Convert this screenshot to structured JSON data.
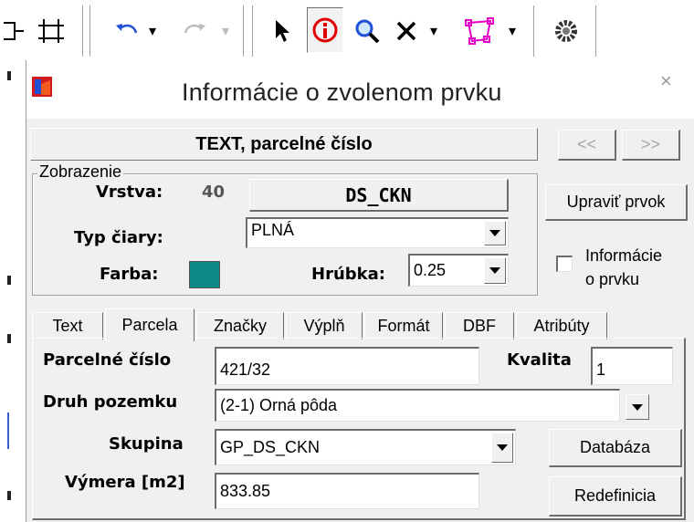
{
  "toolbar": {
    "undo_dropdown": "▾",
    "redo_dropdown": "▾",
    "delete_dropdown": "▾",
    "polygon_dropdown": "▾"
  },
  "dialog": {
    "title": "Informácie o zvolenom prvku",
    "close": "×",
    "header": "TEXT, parcelné číslo",
    "nav_prev": "<<",
    "nav_next": ">>",
    "edit_button": "Upraviť prvok",
    "info_checkbox_label_1": "Informácie",
    "info_checkbox_label_2": "o prvku",
    "info_checkbox_checked": false
  },
  "zobrazenie": {
    "legend": "Zobrazenie",
    "vrstva_label": "Vrstva:",
    "vrstva_number": "40",
    "vrstva_name": "DS_CKN",
    "typ_ciary_label": "Typ čiary:",
    "typ_ciary_value": "PLNÁ",
    "farba_label": "Farba:",
    "farba_color": "#0b8a87",
    "hrubka_label": "Hrúbka:",
    "hrubka_value": "0.25"
  },
  "tabs": [
    {
      "label": "Text",
      "active": false
    },
    {
      "label": "Parcela",
      "active": true
    },
    {
      "label": "Značky",
      "active": false
    },
    {
      "label": "Výplň",
      "active": false
    },
    {
      "label": "Formát",
      "active": false
    },
    {
      "label": "DBF",
      "active": false
    },
    {
      "label": "Atribúty",
      "active": false
    }
  ],
  "parcela": {
    "parcelne_cislo_label": "Parcelné číslo",
    "parcelne_cislo_value": "421/32",
    "kvalita_label": "Kvalita",
    "kvalita_value": "1",
    "druh_pozemku_label": "Druh pozemku",
    "druh_pozemku_value": "(2-1)  Orná pôda",
    "skupina_label": "Skupina",
    "skupina_value": "GP_DS_CKN",
    "vymera_label": "Výmera [m2]",
    "vymera_value": "833.85",
    "databaza_button": "Databáza",
    "redefinicia_button": "Redefinicia"
  }
}
